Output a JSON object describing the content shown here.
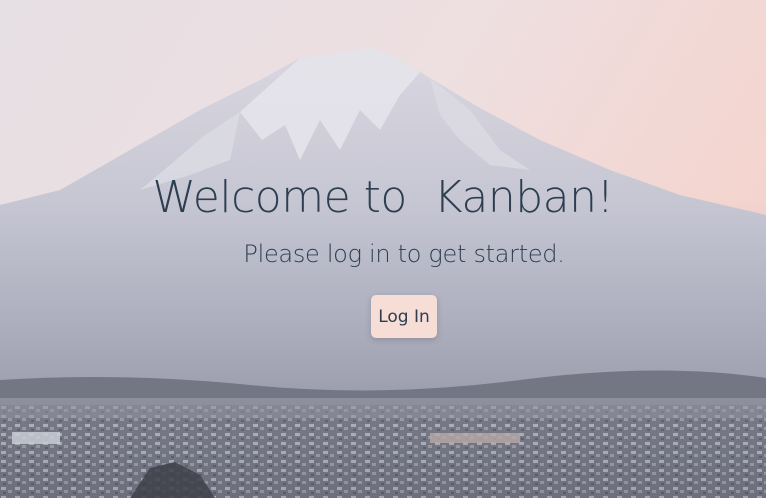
{
  "hero": {
    "title": "Welcome to  Kanban!",
    "subtitle": "Please log in to get started.",
    "login_button": "Log In",
    "background_image": "mount-fuji-over-city"
  },
  "colors": {
    "text": "#2c3e50",
    "button_bg": "#f6ddd6",
    "sky_top": "#e9e0e4",
    "sky_right": "#f3d6d0"
  }
}
